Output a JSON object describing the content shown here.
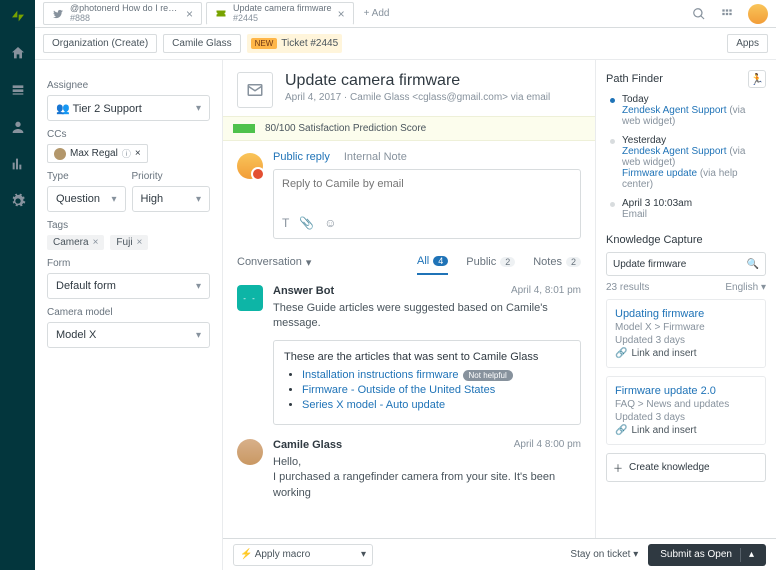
{
  "rail": {
    "items": [
      "logo",
      "home",
      "views",
      "customers",
      "reports",
      "admin"
    ]
  },
  "tabs": [
    {
      "icon": "twitter",
      "title": "@photonerd How do I reset...",
      "num": "#888"
    },
    {
      "icon": "ticket",
      "title": "Update camera firmware",
      "num": "#2445",
      "active": true
    }
  ],
  "addTab": "Add",
  "crumbs": {
    "org": "Organization (Create)",
    "requester": "Camile Glass",
    "badge": "NEW",
    "ticket": "Ticket #2445",
    "apps": "Apps"
  },
  "left": {
    "assignee_label": "Assignee",
    "assignee_value": "Tier 2 Support",
    "ccs_label": "CCs",
    "cc_name": "Max Regal",
    "type_label": "Type",
    "type_value": "Question",
    "priority_label": "Priority",
    "priority_value": "High",
    "tags_label": "Tags",
    "tags": [
      "Camera",
      "Fuji"
    ],
    "form_label": "Form",
    "form_value": "Default form",
    "camera_label": "Camera model",
    "camera_value": "Model X"
  },
  "ticket": {
    "subject": "Update camera firmware",
    "meta": "April 4, 2017 · Camile Glass <cglass@gmail.com> via email",
    "score": "80/100 Satisfaction Prediction Score"
  },
  "reply": {
    "tabs": {
      "public": "Public reply",
      "internal": "Internal Note"
    },
    "placeholder": "Reply to Camile by email"
  },
  "convTabs": {
    "conversation": "Conversation",
    "all": "All",
    "all_count": "4",
    "public": "Public",
    "public_count": "2",
    "notes": "Notes",
    "notes_count": "2"
  },
  "events": {
    "bot": {
      "name": "Answer Bot",
      "time": "April 4, 8:01 pm",
      "text": "These Guide articles were suggested based on Camile's message.",
      "box_intro": "These are the articles that was sent to Camile Glass",
      "articles": [
        {
          "title": "Installation instructions firmware",
          "badge": "Not helpful"
        },
        {
          "title": "Firmware - Outside of the United States"
        },
        {
          "title": "Series X model - Auto update"
        }
      ]
    },
    "user": {
      "name": "Camile Glass",
      "time": "April 4 8:00 pm",
      "line1": "Hello,",
      "line2": "I purchased a rangefinder camera from your site. It's been working"
    }
  },
  "path": {
    "title": "Path Finder",
    "items": [
      {
        "day": "Today",
        "link": "Zendesk Agent Support",
        "meta": "(via web widget)",
        "on": true
      },
      {
        "day": "Yesterday",
        "link": "Zendesk Agent Support",
        "meta": "(via web widget)",
        "link2": "Firmware update",
        "meta2": "(via help center)"
      },
      {
        "day": "April 3 10:03am",
        "meta": "Email"
      }
    ]
  },
  "kc": {
    "title": "Knowledge Capture",
    "search": "Update firmware",
    "results": "23 results",
    "lang": "English",
    "cards": [
      {
        "title": "Updating firmware",
        "path": "Model X > Firmware",
        "upd": "Updated 3 days",
        "action": "Link and insert"
      },
      {
        "title": "Firmware update 2.0",
        "path": "FAQ > News and updates",
        "upd": "Updated 3 days",
        "action": "Link and insert"
      }
    ],
    "create": "Create knowledge"
  },
  "footer": {
    "macro": "Apply macro",
    "stay": "Stay on ticket",
    "submit": "Submit as Open"
  }
}
